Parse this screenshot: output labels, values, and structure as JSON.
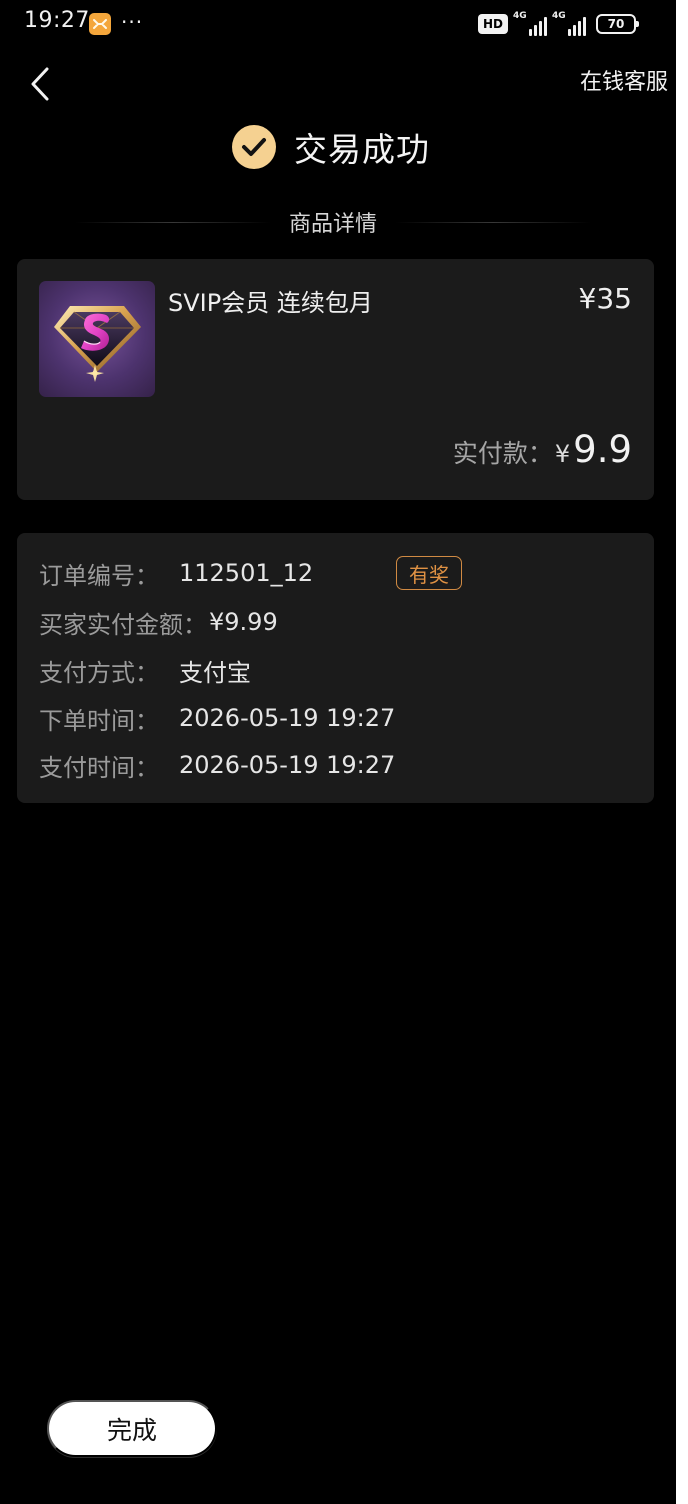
{
  "status_bar": {
    "time": "19:27",
    "more": "···",
    "hd": "HD",
    "network_1": "4G",
    "network_2": "4G",
    "battery": "70",
    "colors": {
      "app_icon": "#f4a63b"
    }
  },
  "header": {
    "service_label": "在钱客服",
    "success_title": "交易成功",
    "icon_names": {
      "back": "chevron-left-icon",
      "success": "check-circle-icon"
    },
    "accent": "#f5d191"
  },
  "product_section": {
    "title": "商品详情",
    "product": {
      "name": "SVIP会员 连续包月",
      "price": "¥35",
      "paid_label": "实付款：",
      "paid_currency": "¥",
      "paid_value": "9.9",
      "thumbnail_icon": "svip-diamond-icon"
    }
  },
  "order_info": {
    "rows": [
      {
        "label": "订单编号：",
        "value": "112501_12",
        "badge": "有奖"
      },
      {
        "label": "买家实付金额：",
        "value": "¥9.99"
      },
      {
        "label": "支付方式：",
        "value": "支付宝"
      },
      {
        "label": "下单时间：",
        "value": "2026-05-19 19:27"
      },
      {
        "label": "支付时间：",
        "value": "2026-05-19 19:27"
      }
    ],
    "colors": {
      "badge": "#e09244"
    }
  },
  "footer": {
    "done_label": "完成"
  }
}
